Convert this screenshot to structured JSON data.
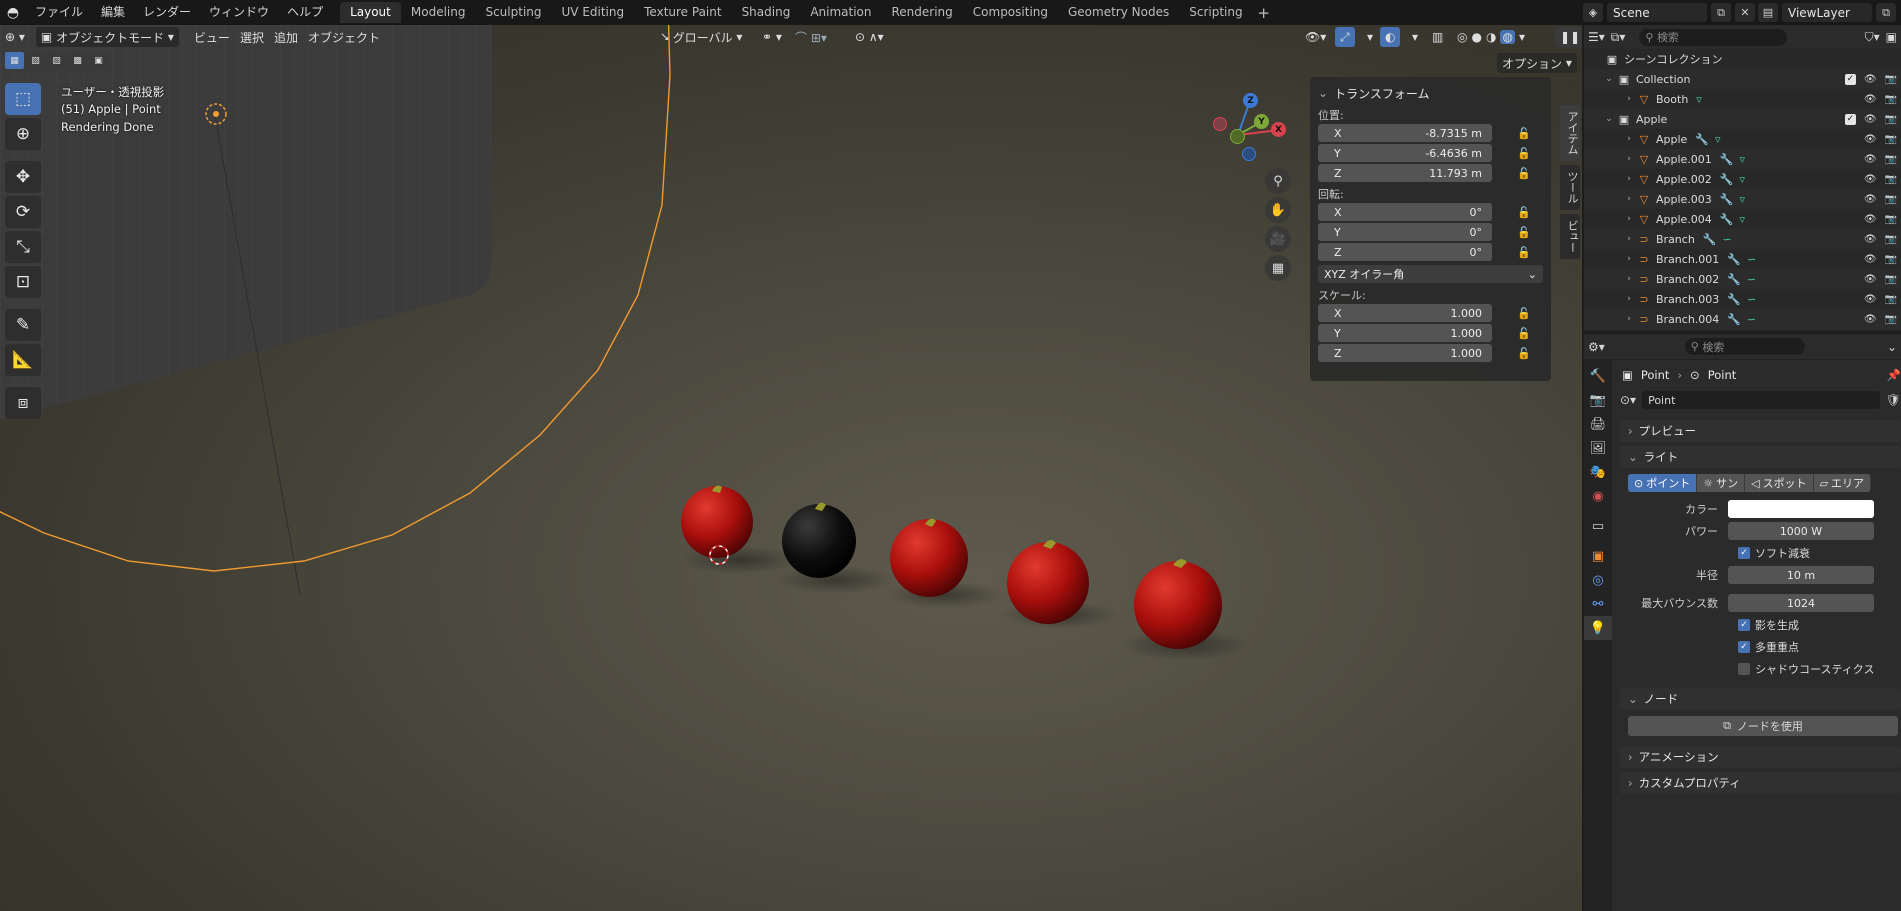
{
  "menu": {
    "logo": "◓",
    "items": [
      "ファイル",
      "編集",
      "レンダー",
      "ウィンドウ",
      "ヘルプ"
    ]
  },
  "workspaces": [
    "Layout",
    "Modeling",
    "Sculpting",
    "UV Editing",
    "Texture Paint",
    "Shading",
    "Animation",
    "Rendering",
    "Compositing",
    "Geometry Nodes",
    "Scripting"
  ],
  "workspace_add": "+",
  "scene": {
    "name": "Scene",
    "view_layer": "ViewLayer"
  },
  "viewport": {
    "mode": "オブジェクトモード",
    "menus": [
      "ビュー",
      "選択",
      "追加",
      "オブジェクト"
    ],
    "transform_orientation": "グローバル",
    "options_label": "オプション",
    "overlay_lines": [
      "ユーザー・透視投影",
      "(51) Apple | Point",
      "Rendering Done"
    ],
    "gizmo_labels": {
      "x": "X",
      "y": "Y",
      "z": "Z"
    }
  },
  "npanel": {
    "title": "トランスフォーム",
    "location_label": "位置:",
    "location": [
      {
        "axis": "X",
        "value": "-8.7315 m"
      },
      {
        "axis": "Y",
        "value": "-6.4636 m"
      },
      {
        "axis": "Z",
        "value": "11.793 m"
      }
    ],
    "rotation_label": "回転:",
    "rotation": [
      {
        "axis": "X",
        "value": "0°"
      },
      {
        "axis": "Y",
        "value": "0°"
      },
      {
        "axis": "Z",
        "value": "0°"
      }
    ],
    "rotation_mode": "XYZ オイラー角",
    "scale_label": "スケール:",
    "scale": [
      {
        "axis": "X",
        "value": "1.000"
      },
      {
        "axis": "Y",
        "value": "1.000"
      },
      {
        "axis": "Z",
        "value": "1.000"
      }
    ],
    "side_tabs": [
      "アイテム",
      "ツール",
      "ビュー"
    ]
  },
  "outliner": {
    "search_placeholder": "検索",
    "root": "シーンコレクション",
    "rows": [
      {
        "label": "Collection",
        "kind": "collection"
      },
      {
        "label": "Booth",
        "kind": "mesh"
      },
      {
        "label": "Apple",
        "kind": "collection"
      },
      {
        "label": "Apple",
        "kind": "mesh"
      },
      {
        "label": "Apple.001",
        "kind": "mesh"
      },
      {
        "label": "Apple.002",
        "kind": "mesh"
      },
      {
        "label": "Apple.003",
        "kind": "mesh"
      },
      {
        "label": "Apple.004",
        "kind": "mesh"
      },
      {
        "label": "Branch",
        "kind": "curve"
      },
      {
        "label": "Branch.001",
        "kind": "curve"
      },
      {
        "label": "Branch.002",
        "kind": "curve"
      },
      {
        "label": "Branch.003",
        "kind": "curve"
      },
      {
        "label": "Branch.004",
        "kind": "curve"
      }
    ]
  },
  "properties": {
    "search_placeholder": "検索",
    "breadcrumb": [
      "Point",
      "Point"
    ],
    "data_name": "Point",
    "panels": {
      "preview": "プレビュー",
      "light": "ライト",
      "nodes": "ノード",
      "animation": "アニメーション",
      "custom": "カスタムプロパティ"
    },
    "light_types": [
      "ポイント",
      "サン",
      "スポット",
      "エリア"
    ],
    "color_label": "カラー",
    "power_label": "パワー",
    "power": "1000 W",
    "soft_falloff": "ソフト減衰",
    "radius_label": "半径",
    "radius": "10 m",
    "max_bounces_label": "最大バウンス数",
    "max_bounces": "1024",
    "cast_shadow": "影を生成",
    "multiple_importance": "多重重点",
    "shadow_caustics": "シャドウコースティクス",
    "use_nodes": "ノードを使用"
  },
  "colors": {
    "accent": "#4772b3",
    "selection": "#f0a030",
    "light_swatch": "#ffffff"
  }
}
